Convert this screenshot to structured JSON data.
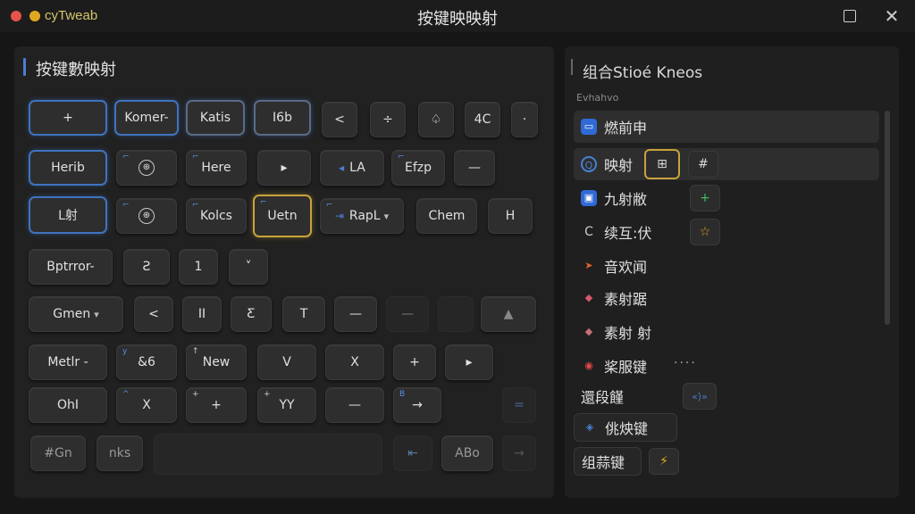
{
  "window": {
    "app_name": "cyTweab",
    "title": "按键映映射"
  },
  "left": {
    "title": "按键數映射",
    "keys": [
      {
        "label": "+"
      },
      {
        "label": "Komer-"
      },
      {
        "label": "Katis"
      },
      {
        "label": "I6b"
      },
      {
        "label": "<"
      },
      {
        "label": "÷"
      },
      {
        "label": "♤"
      },
      {
        "label": "4C"
      },
      {
        "label": "·"
      },
      {
        "label": "Herib"
      },
      {
        "label": "⊕"
      },
      {
        "label": "Here"
      },
      {
        "label": "▸"
      },
      {
        "label": "LA"
      },
      {
        "label": "Efzp"
      },
      {
        "label": "—"
      },
      {
        "label": "L射"
      },
      {
        "label": "⊕"
      },
      {
        "label": "Kolcs"
      },
      {
        "label": "Uetn"
      },
      {
        "label": "RapL"
      },
      {
        "label": "Chem"
      },
      {
        "label": "H"
      },
      {
        "label": "Bptrror-"
      },
      {
        "label": "Ƨ"
      },
      {
        "label": "1"
      },
      {
        "label": "˅"
      },
      {
        "label": "Gmen"
      },
      {
        "label": "<"
      },
      {
        "label": "II"
      },
      {
        "label": "Ƹ"
      },
      {
        "label": "T"
      },
      {
        "label": "—"
      },
      {
        "label": "—"
      },
      {
        "label": "▲"
      },
      {
        "label": "Metlr -"
      },
      {
        "label": "&6"
      },
      {
        "label": "New"
      },
      {
        "label": "V"
      },
      {
        "label": "X"
      },
      {
        "label": "+"
      },
      {
        "label": "▸"
      },
      {
        "label": "OhI"
      },
      {
        "label": "X"
      },
      {
        "label": "+"
      },
      {
        "label": "YY"
      },
      {
        "label": "—"
      },
      {
        "label": "→"
      },
      {
        "label": "="
      },
      {
        "label": "#Gn"
      },
      {
        "label": "nks"
      },
      {
        "label": "⇤"
      },
      {
        "label": "ABo"
      },
      {
        "label": "→"
      }
    ]
  },
  "right": {
    "title": "组合Stioé Kneos",
    "subtitle": "Evhahvo",
    "items": [
      {
        "label": "燃前申"
      },
      {
        "label": "映射"
      },
      {
        "label": "九射敝"
      },
      {
        "label": "续互:伏"
      },
      {
        "label": "音欢闻"
      },
      {
        "label": "素射踞"
      },
      {
        "label": "素射 射"
      },
      {
        "label": "桨服键"
      },
      {
        "label": "還段饉"
      },
      {
        "label": "佻炴键"
      },
      {
        "label": "组蒜键"
      }
    ],
    "more": "····",
    "mini_icons": {
      "a": "⊞",
      "b": "#",
      "c": "+",
      "d": "☆",
      "e": "«⟩»",
      "f": "⚡"
    }
  }
}
